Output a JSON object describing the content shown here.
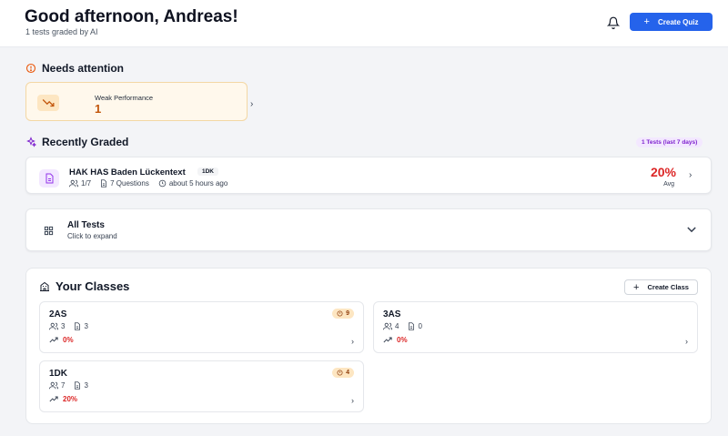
{
  "header": {
    "greeting": "Good afternoon, Andreas!",
    "subtitle": "1 tests graded by AI",
    "create_quiz_label": "Create Quiz"
  },
  "attention": {
    "title": "Needs attention",
    "weak_label": "Weak Performance",
    "weak_count": "1"
  },
  "recent": {
    "title": "Recently Graded",
    "badge": "1 Tests (last 7 days)",
    "item": {
      "name": "HAK HAS Baden Lückentext",
      "tag": "1DK",
      "students": "1/7",
      "questions": "7 Questions",
      "time": "about 5 hours ago",
      "avg_value": "20%",
      "avg_label": "Avg"
    }
  },
  "all_tests": {
    "title": "All Tests",
    "subtitle": "Click to expand"
  },
  "classes": {
    "title": "Your Classes",
    "create_label": "Create Class",
    "items": [
      {
        "name": "2AS",
        "warn": "9",
        "students": "3",
        "tests": "3",
        "perf": "0%"
      },
      {
        "name": "3AS",
        "warn": "",
        "students": "4",
        "tests": "0",
        "perf": "0%"
      },
      {
        "name": "1DK",
        "warn": "4",
        "students": "7",
        "tests": "3",
        "perf": "20%"
      }
    ]
  },
  "colors": {
    "accent": "#2563eb",
    "danger": "#dc2626",
    "warning": "#c2560c",
    "purple": "#7e22ce"
  }
}
